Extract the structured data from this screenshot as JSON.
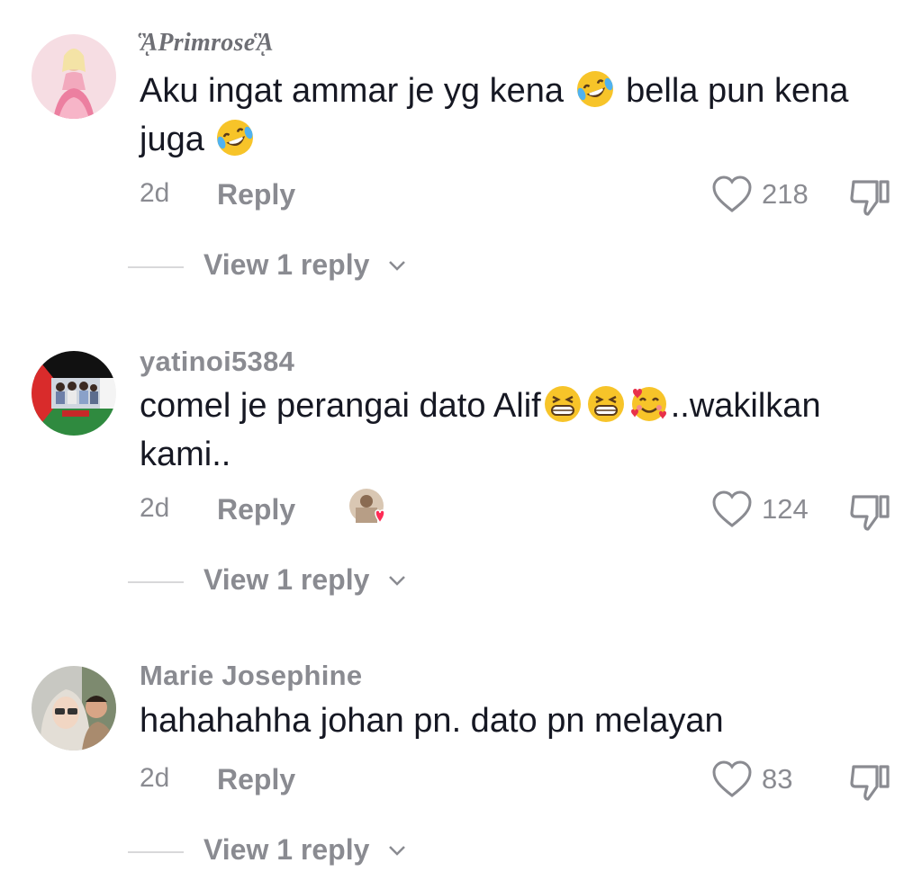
{
  "comments": [
    {
      "username": "ᾋPrimroseᾋ",
      "text_parts": [
        "Aku ingat ammar je yg kena ",
        " bella pun kena juga "
      ],
      "emoji": [
        "rolling-on-floor-laughing",
        "rolling-on-floor-laughing"
      ],
      "time": "2d",
      "reply_label": "Reply",
      "likes": "218",
      "view_replies": "View 1 reply"
    },
    {
      "username": "yatinoi5384",
      "text_parts": [
        "comel je perangai dato Alif",
        "..wakilkan kami.."
      ],
      "emoji": [
        "grinning-squinting",
        "grinning-squinting",
        "smiling-with-hearts"
      ],
      "time": "2d",
      "reply_label": "Reply",
      "likes": "124",
      "view_replies": "View 1 reply",
      "creator_liked": true
    },
    {
      "username": "Marie Josephine",
      "text": "hahahahha johan pn. dato pn melayan",
      "time": "2d",
      "reply_label": "Reply",
      "likes": "83",
      "view_replies": "View 1 reply"
    }
  ],
  "icons": {
    "like": "heart-outline-icon",
    "dislike": "thumbs-down-icon",
    "expand": "chevron-down-icon"
  },
  "colors": {
    "text": "#161823",
    "muted": "#8a8b91",
    "heart_badge": "#fe2c55"
  }
}
